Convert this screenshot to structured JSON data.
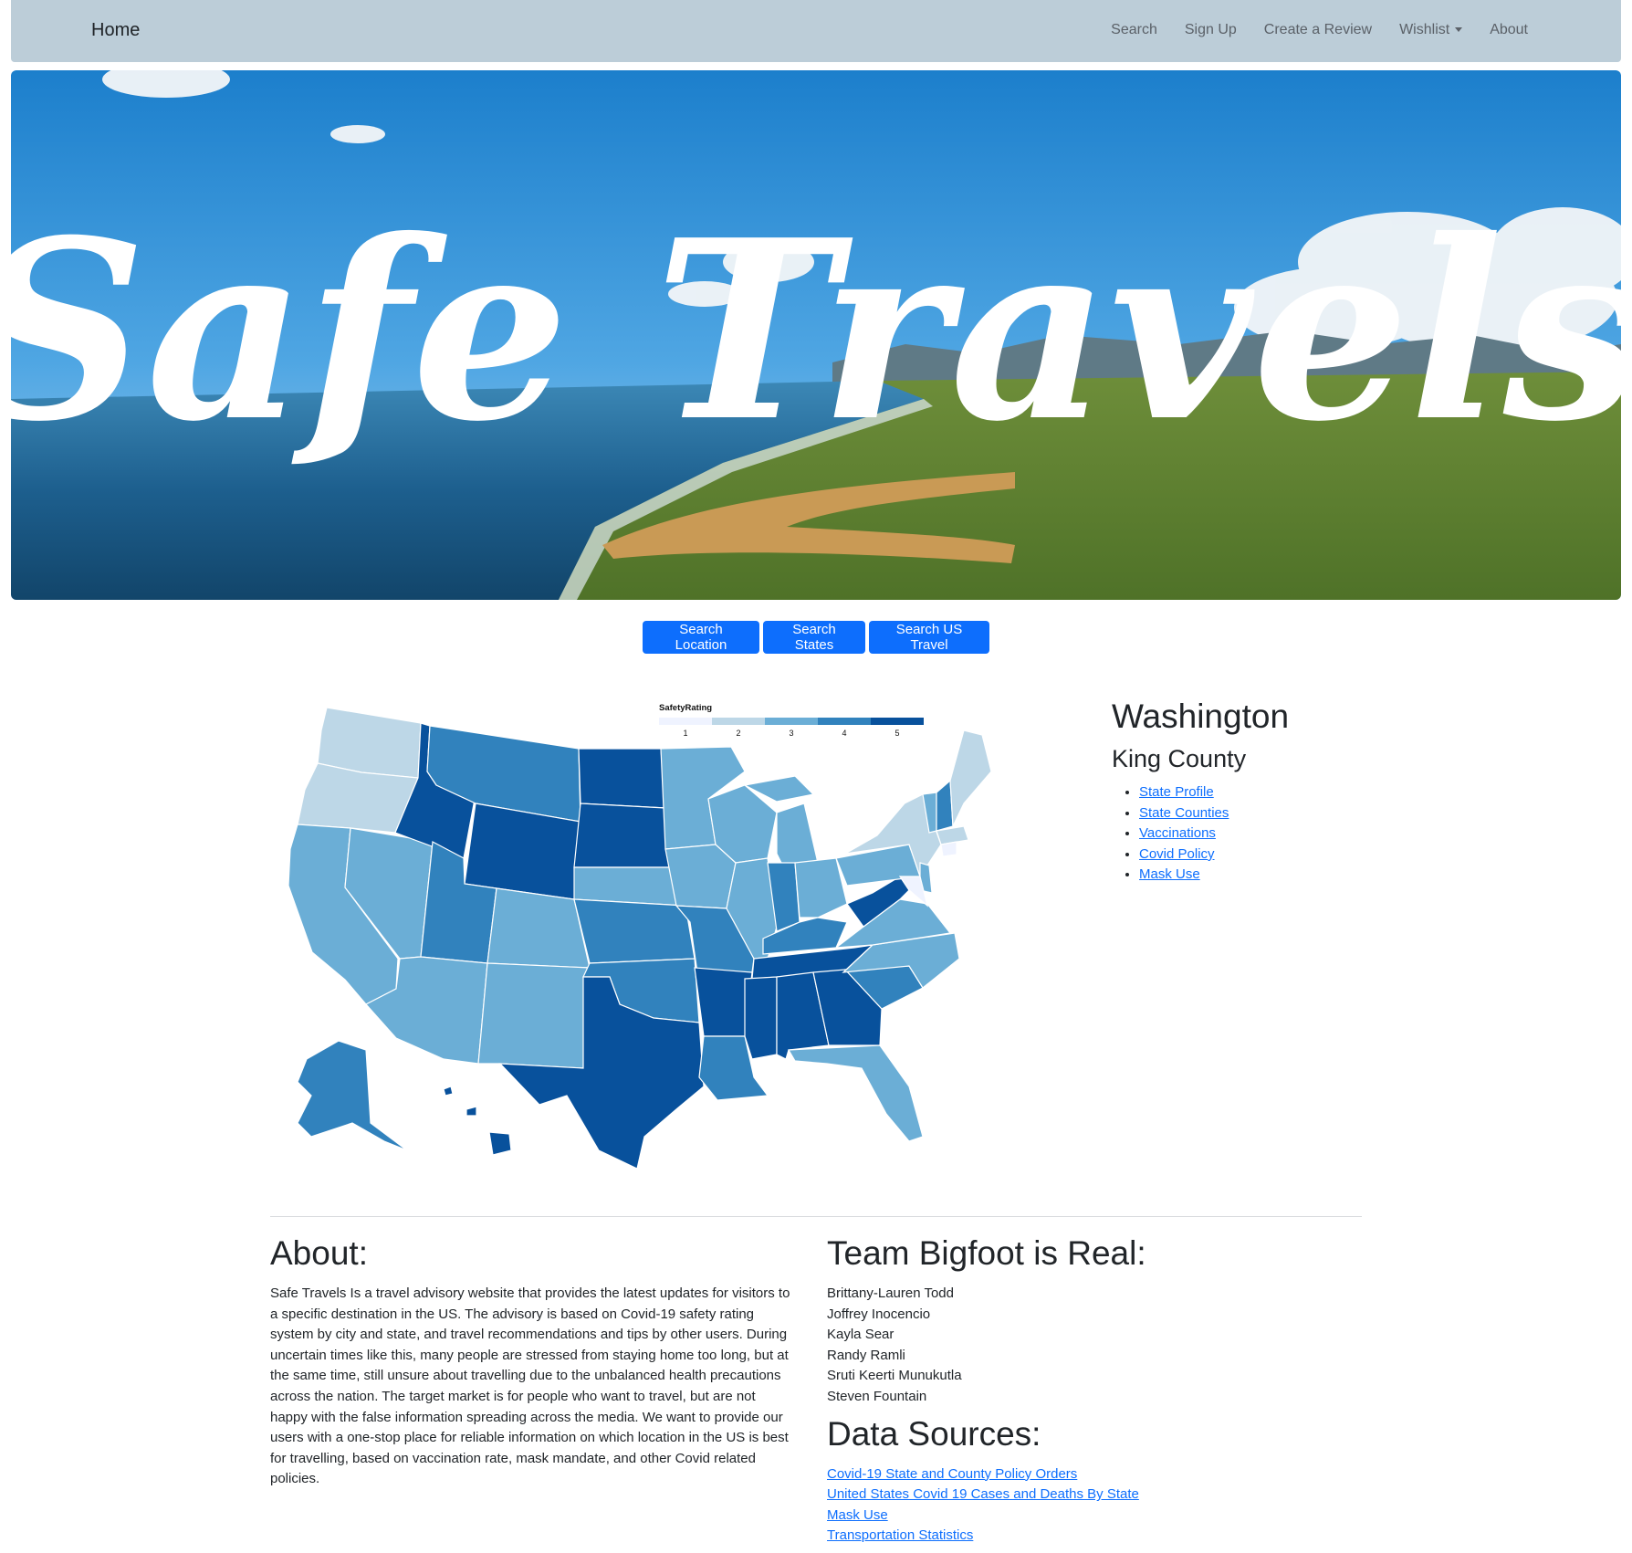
{
  "nav": {
    "brand": "Home",
    "links": [
      "Search",
      "Sign Up",
      "Create a Review",
      "Wishlist",
      "About"
    ]
  },
  "hero": {
    "title": "Safe Travels"
  },
  "buttons": [
    "Search Location",
    "Search States",
    "Search US Travel"
  ],
  "map": {
    "legend_title": "SafetyRating",
    "legend_ticks": [
      "1",
      "2",
      "3",
      "4",
      "5"
    ],
    "scale_colors": [
      "#eff3ff",
      "#bdd7e7",
      "#6baed6",
      "#3182bd",
      "#08519c"
    ]
  },
  "location": {
    "state": "Washington",
    "county": "King County",
    "links": [
      "State Profile",
      "State Counties",
      "Vaccinations",
      "Covid Policy",
      "Mask Use"
    ]
  },
  "about": {
    "heading": "About:",
    "body": "Safe Travels Is a travel advisory website that provides the latest updates for visitors to a specific destination in the US. The advisory is based on Covid-19 safety rating system by city and state, and travel recommendations and tips by other users. During uncertain times like this, many people are stressed from staying home too long, but at the same time, still unsure about travelling due to the unbalanced health precautions across the nation. The target market is for people who want to travel, but are not happy with the false information spreading across the media. We want to provide our users with a one-stop place for reliable information on which location in the US is best for travelling, based on vaccination rate, mask mandate, and other Covid related policies."
  },
  "team": {
    "heading": "Team Bigfoot is Real:",
    "members": [
      "Brittany-Lauren Todd",
      "Joffrey Inocencio",
      "Kayla Sear",
      "Randy Ramli",
      "Sruti Keerti Munukutla",
      "Steven Fountain"
    ]
  },
  "sources": {
    "heading": "Data Sources:",
    "links": [
      "Covid-19 State and County Policy Orders",
      "United States Covid 19 Cases and Deaths By State",
      "Mask Use",
      "Transportation Statistics"
    ]
  }
}
